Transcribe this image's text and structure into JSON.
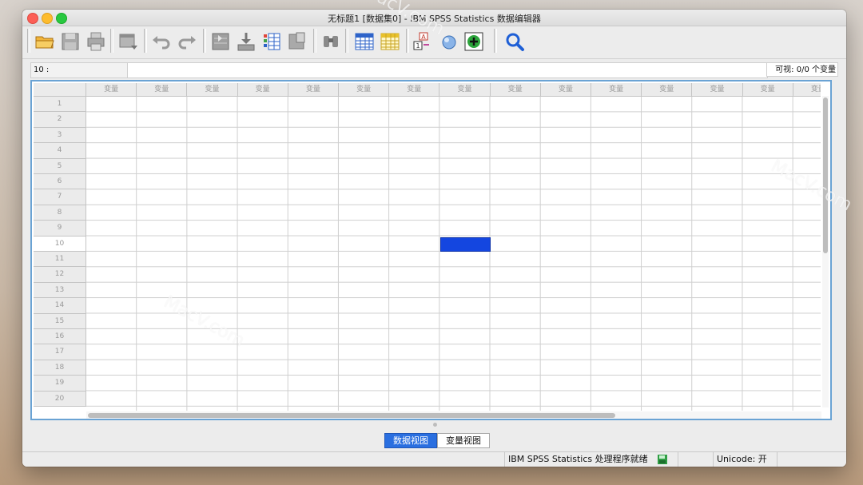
{
  "window": {
    "title": "无标题1 [数据集0] - IBM SPSS Statistics 数据编辑器"
  },
  "toolbar": {
    "buttons": [
      {
        "name": "open-icon"
      },
      {
        "name": "save-icon"
      },
      {
        "name": "print-icon"
      },
      {
        "name": "dialog-recall-icon"
      },
      {
        "name": "undo-icon"
      },
      {
        "name": "redo-icon"
      },
      {
        "name": "goto-case-icon"
      },
      {
        "name": "goto-variable-icon"
      },
      {
        "name": "variables-icon"
      },
      {
        "name": "run-descriptives-icon"
      },
      {
        "name": "find-icon"
      },
      {
        "name": "insert-cases-icon"
      },
      {
        "name": "insert-variable-icon"
      },
      {
        "name": "value-labels-icon"
      },
      {
        "name": "use-sets-icon"
      },
      {
        "name": "add-ons-icon"
      },
      {
        "name": "search-icon"
      }
    ]
  },
  "cellbar": {
    "cell_ref": "10 :",
    "cell_value": "",
    "visible_label": "可视: 0/0 个变量"
  },
  "grid": {
    "column_header": "变量",
    "columns": [
      "变量",
      "变量",
      "变量",
      "变量",
      "变量",
      "变量",
      "变量",
      "变量",
      "变量",
      "变量",
      "变量",
      "变量",
      "变量",
      "变量",
      "变量"
    ],
    "rows": [
      "1",
      "2",
      "3",
      "4",
      "5",
      "6",
      "7",
      "8",
      "9",
      "10",
      "11",
      "12",
      "13",
      "14",
      "15",
      "16",
      "17",
      "18",
      "19",
      "20"
    ],
    "selected_row": "10",
    "selected_col_index": 7,
    "selected_color": "#1446e0"
  },
  "tabs": [
    {
      "label": "数据视图",
      "active": true
    },
    {
      "label": "变量视图",
      "active": false
    }
  ],
  "statusbar": {
    "processor": "IBM SPSS Statistics 处理程序就绪",
    "unicode": "Unicode: 开"
  },
  "watermarks": [
    "MacV.com",
    "MacV.com",
    "MacV.com"
  ]
}
